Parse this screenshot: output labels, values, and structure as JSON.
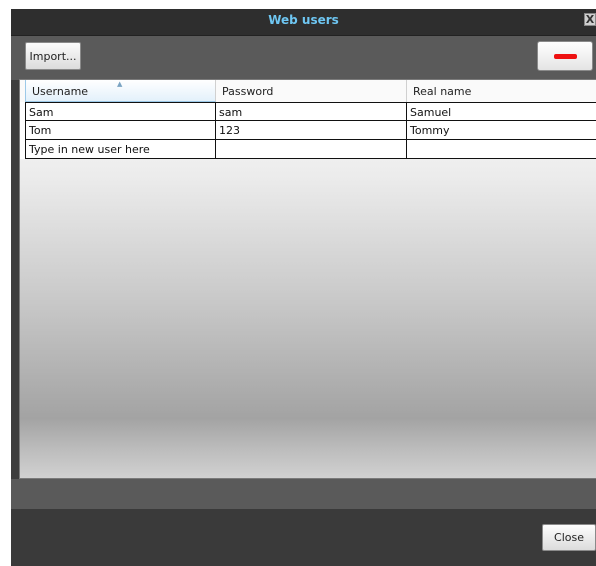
{
  "window": {
    "title": "Web users",
    "close_glyph": "X"
  },
  "toolbar": {
    "import_label": "Import...",
    "remove_icon": "minus-icon"
  },
  "grid": {
    "columns": [
      "Username",
      "Password",
      "Real name"
    ],
    "sorted_column": "Username",
    "rows": [
      [
        "Sam",
        "sam",
        "Samuel"
      ],
      [
        "Tom",
        "123",
        "Tommy"
      ]
    ],
    "new_row_placeholder": "Type in new user here"
  },
  "footer": {
    "close_label": "Close"
  },
  "colors": {
    "title": "#6ec6f2",
    "remove_icon": "#ee1111"
  }
}
